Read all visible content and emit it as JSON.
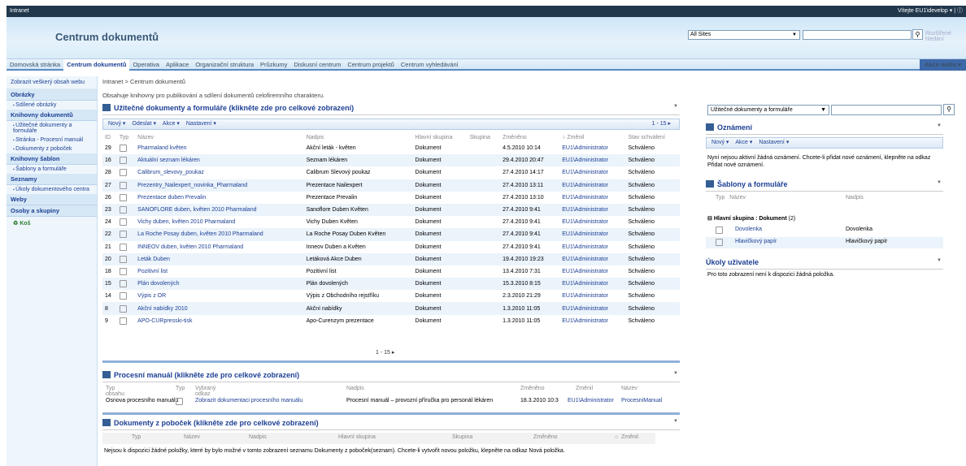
{
  "app": {
    "intranet": "Intranet",
    "welcome": "Vítejte EU1\\develop ▾ | ⓘ",
    "site_title": "Centrum dokumentů",
    "scope": "All Sites",
    "advanced": "Rozšířené hledání"
  },
  "nav": [
    "Domovská stránka",
    "Centrum dokumentů",
    "Operativa",
    "Aplikace",
    "Organizační struktura",
    "Průzkumy",
    "Diskusní centrum",
    "Centrum projektů",
    "Centrum vyhledávání"
  ],
  "akce_webu": "Akce webu ▾",
  "leftnav": {
    "view_all": "Zobrazit veškerý obsah webu",
    "sections": [
      {
        "h": "Obrázky",
        "items": [
          "Sdílené obrázky"
        ]
      },
      {
        "h": "Knihovny dokumentů",
        "items": [
          "Užitečné dokumenty a formuláře",
          "Stránka - Procesní manuál",
          "Dokumenty z poboček"
        ]
      },
      {
        "h": "Knihovny šablon",
        "items": [
          "Šablony a formuláře"
        ]
      },
      {
        "h": "Seznamy",
        "items": [
          "Úkoly dokumentového centra"
        ]
      },
      {
        "h": "Weby",
        "items": []
      },
      {
        "h": "Osoby a skupiny",
        "items": []
      }
    ],
    "bin": "Koš"
  },
  "crumb": "Intranet > Centrum dokumentů",
  "desc": "Obsahuje knihovny pro publikování a sdílení dokumentů celofiremního charakteru.",
  "wp1": {
    "title": "Užitečné dokumenty a formuláře (klikněte zde pro celkové zobrazení)",
    "toolbar": [
      "Nový ▾",
      "Odeslat ▾",
      "Akce ▾",
      "Nastavení ▾"
    ],
    "range": "1 - 15 ▸",
    "cols": [
      "ID",
      "Typ",
      "Název",
      "Nadpis",
      "Hlavní skupina",
      "Skupina",
      "Změněno",
      "Změnil",
      "Stav schválení"
    ],
    "rows": [
      [
        "29",
        "Pharmaland květen",
        "Akční leták - květen",
        "Dokument",
        "",
        "4.5.2010 10:14",
        "EU1\\Administrator",
        "Schváleno"
      ],
      [
        "16",
        "Aktuální seznam lékáren",
        "Seznam lékáren",
        "Dokument",
        "",
        "29.4.2010 20:47",
        "EU1\\Administrator",
        "Schváleno"
      ],
      [
        "28",
        "Calibrum_slevovy_poukaz",
        "Calibrum Slevový poukaz",
        "Dokument",
        "",
        "27.4.2010 14:17",
        "EU1\\Administrator",
        "Schváleno"
      ],
      [
        "27",
        "Prezentry_Nailexpert_novinka_Pharmaland",
        "Prezentace Nailexpert",
        "Dokument",
        "",
        "27.4.2010 13:11",
        "EU1\\Administrator",
        "Schváleno"
      ],
      [
        "26",
        "Prezentace duben Prevalin",
        "Prezentace Prevalin",
        "Dokument",
        "",
        "27.4.2010 13:10",
        "EU1\\Administrator",
        "Schváleno"
      ],
      [
        "23",
        "SANOFLORE duben, květen 2010 Pharmaland",
        "Sanoflore Duben Květen",
        "Dokument",
        "",
        "27.4.2010 9:41",
        "EU1\\Administrator",
        "Schváleno"
      ],
      [
        "24",
        "Vichy duben, květen 2010 Pharmaland",
        "Vichy Duben Květen",
        "Dokument",
        "",
        "27.4.2010 9:41",
        "EU1\\Administrator",
        "Schváleno"
      ],
      [
        "22",
        "La Roche Posay duben, květen 2010 Pharmaland",
        "La Roche Posay Duben Květen",
        "Dokument",
        "",
        "27.4.2010 9:41",
        "EU1\\Administrator",
        "Schváleno"
      ],
      [
        "21",
        "INNEOV duben, květen 2010 Pharmaland",
        "Inneov Duben a Květen",
        "Dokument",
        "",
        "27.4.2010 9:41",
        "EU1\\Administrator",
        "Schváleno"
      ],
      [
        "20",
        "Leták Duben",
        "Letáková Akce Duben",
        "Dokument",
        "",
        "19.4.2010 19:23",
        "EU1\\Administrator",
        "Schváleno"
      ],
      [
        "18",
        "Pozitivní list",
        "Pozitivní list",
        "Dokument",
        "",
        "13.4.2010 7:31",
        "EU1\\Administrator",
        "Schváleno"
      ],
      [
        "15",
        "Plán dovolených",
        "Plán dovolených",
        "Dokument",
        "",
        "15.3.2010 8:15",
        "EU1\\Administrator",
        "Schváleno"
      ],
      [
        "14",
        "Výpis z OR",
        "Výpis z Obchodního rejstříku",
        "Dokument",
        "",
        "2.3.2010 21:29",
        "EU1\\Administrator",
        "Schváleno"
      ],
      [
        "8",
        "Akční nabídky 2010",
        "Akční nabídky",
        "Dokument",
        "",
        "1.3.2010 11:05",
        "EU1\\Administrator",
        "Schváleno"
      ],
      [
        "9",
        "APO-CURpresski-tisk",
        "Apo-Curenzym prezentace",
        "Dokument",
        "",
        "1.3.2010 11:05",
        "EU1\\Administrator",
        "Schváleno"
      ]
    ],
    "pager": "1 - 15 ▸"
  },
  "wp2": {
    "title": "Procesní manuál (klikněte zde pro celkové zobrazení)",
    "cols": [
      "Typ obsahu",
      "Typ",
      "Vybraný odkaz",
      "Nadpis",
      "Změněno",
      "Změnil",
      "Název"
    ],
    "row": [
      "Osnova procesního manuálu",
      "Zobrazit dokumentaci procesního manuálu",
      "Procesní manuál – provozní příručka pro personál lékáren",
      "18.3.2010 10:3",
      "EU1\\Administrator",
      "ProcesniManual"
    ]
  },
  "wp3": {
    "title": "Dokumenty z poboček (klikněte zde pro celkové zobrazení)",
    "cols": [
      "Typ",
      "Název",
      "Nadpis",
      "Hlavní skupina",
      "Skupina",
      "Změněno",
      "Změnil"
    ],
    "empty": "Nejsou k dispozici žádné položky, které by bylo možné v tomto zobrazení seznamu Dokumenty z poboček(seznam). Chcete-li vytvořit novou položku, klepněte na odkaz Nová položka."
  },
  "right": {
    "search_scope": "Užitečné dokumenty a formuláře",
    "ann_title": "Oznámení",
    "ann_toolbar": [
      "Nový ▾",
      "Akce ▾",
      "Nastavení ▾"
    ],
    "ann_text": "Nyní nejsou aktivní žádná oznámení. Chcete-li přidat nové oznámení, klepněte na odkaz Přidat nové oznámení.",
    "tpl_title": "Šablony a formuláře",
    "tpl_cols": [
      "Typ",
      "Název",
      "Nadpis"
    ],
    "tpl_group": "Hlavní skupina : Dokument",
    "tpl_count": "(2)",
    "tpl_rows": [
      [
        "Dovolenka",
        "Dovolenka"
      ],
      [
        "Hlavičkový papír",
        "Hlavičkový papír"
      ]
    ],
    "tasks_title": "Úkoly uživatele",
    "tasks_text": "Pro toto zobrazení není k dispozici žádná položka."
  }
}
